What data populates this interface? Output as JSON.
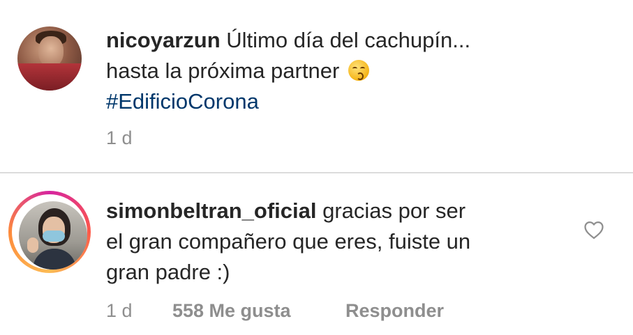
{
  "post": {
    "username": "nicoyarzun",
    "caption_line1": "Último día del cachupín...",
    "caption_line2": "hasta la próxima partner",
    "emoji": "kissing-face-emoji",
    "hashtag": "#EdificioCorona",
    "time": "1 d"
  },
  "comment": {
    "username": "simonbeltran_oficial",
    "text_part1": "gracias por ser",
    "text_line2": "el gran compañero que eres, fuiste un",
    "text_line3": "gran padre :)",
    "time": "1 d",
    "likes": "558 Me gusta",
    "reply_label": "Responder",
    "like_icon": "heart-outline-icon"
  },
  "colors": {
    "text": "#262626",
    "muted": "#8e8e8e",
    "hashtag": "#00376b",
    "divider": "#dbdbdb"
  }
}
